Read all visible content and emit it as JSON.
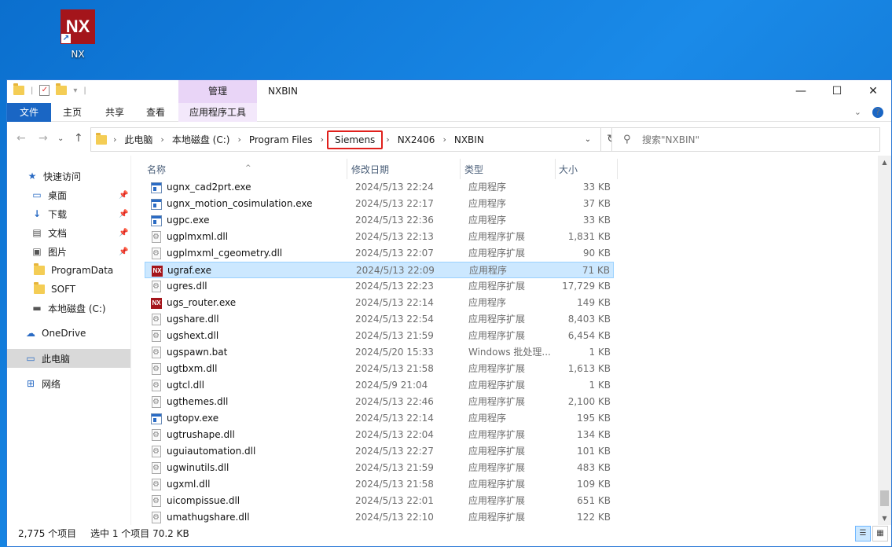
{
  "desktop": {
    "icon_label": "NX",
    "icon_logo": "NX"
  },
  "window": {
    "title": "NXBIN",
    "manage_tab": "管理",
    "app_tools_tab": "应用程序工具",
    "ribbon_tabs": [
      "文件",
      "主页",
      "共享",
      "查看"
    ]
  },
  "address": {
    "crumbs": [
      "此电脑",
      "本地磁盘 (C:)",
      "Program Files",
      "Siemens",
      "NX2406",
      "NXBIN"
    ],
    "highlighted": "Siemens"
  },
  "search": {
    "placeholder": "搜索\"NXBIN\""
  },
  "nav": {
    "items": [
      {
        "label": "快速访问",
        "icon": "star-icon",
        "pinned": false
      },
      {
        "label": "桌面",
        "icon": "desktop-icon",
        "pinned": true
      },
      {
        "label": "下载",
        "icon": "download-icon",
        "pinned": true
      },
      {
        "label": "文档",
        "icon": "document-icon",
        "pinned": true
      },
      {
        "label": "图片",
        "icon": "picture-icon",
        "pinned": true
      },
      {
        "label": "ProgramData",
        "icon": "folder-icon",
        "pinned": false
      },
      {
        "label": "SOFT",
        "icon": "folder-icon",
        "pinned": false
      },
      {
        "label": "本地磁盘 (C:)",
        "icon": "drive-icon",
        "pinned": false
      },
      {
        "label": "OneDrive",
        "icon": "cloud-icon",
        "pinned": false
      },
      {
        "label": "此电脑",
        "icon": "computer-icon",
        "pinned": false,
        "selected": true
      },
      {
        "label": "网络",
        "icon": "network-icon",
        "pinned": false
      }
    ]
  },
  "columns": {
    "name": "名称",
    "date": "修改日期",
    "type": "类型",
    "size": "大小"
  },
  "files": [
    {
      "name": "ugnx_cad2prt.exe",
      "date": "2024/5/13 22:24",
      "type": "应用程序",
      "size": "33 KB",
      "icon": "exe"
    },
    {
      "name": "ugnx_motion_cosimulation.exe",
      "date": "2024/5/13 22:17",
      "type": "应用程序",
      "size": "37 KB",
      "icon": "exe"
    },
    {
      "name": "ugpc.exe",
      "date": "2024/5/13 22:36",
      "type": "应用程序",
      "size": "33 KB",
      "icon": "exe"
    },
    {
      "name": "ugplmxml.dll",
      "date": "2024/5/13 22:13",
      "type": "应用程序扩展",
      "size": "1,831 KB",
      "icon": "dll"
    },
    {
      "name": "ugplmxml_cgeometry.dll",
      "date": "2024/5/13 22:07",
      "type": "应用程序扩展",
      "size": "90 KB",
      "icon": "dll"
    },
    {
      "name": "ugraf.exe",
      "date": "2024/5/13 22:09",
      "type": "应用程序",
      "size": "71 KB",
      "icon": "nx",
      "selected": true
    },
    {
      "name": "ugres.dll",
      "date": "2024/5/13 22:23",
      "type": "应用程序扩展",
      "size": "17,729 KB",
      "icon": "dll"
    },
    {
      "name": "ugs_router.exe",
      "date": "2024/5/13 22:14",
      "type": "应用程序",
      "size": "149 KB",
      "icon": "nx"
    },
    {
      "name": "ugshare.dll",
      "date": "2024/5/13 22:54",
      "type": "应用程序扩展",
      "size": "8,403 KB",
      "icon": "dll"
    },
    {
      "name": "ugshext.dll",
      "date": "2024/5/13 21:59",
      "type": "应用程序扩展",
      "size": "6,454 KB",
      "icon": "dll"
    },
    {
      "name": "ugspawn.bat",
      "date": "2024/5/20 15:33",
      "type": "Windows 批处理...",
      "size": "1 KB",
      "icon": "dll"
    },
    {
      "name": "ugtbxm.dll",
      "date": "2024/5/13 21:58",
      "type": "应用程序扩展",
      "size": "1,613 KB",
      "icon": "dll"
    },
    {
      "name": "ugtcl.dll",
      "date": "2024/5/9 21:04",
      "type": "应用程序扩展",
      "size": "1 KB",
      "icon": "dll"
    },
    {
      "name": "ugthemes.dll",
      "date": "2024/5/13 22:46",
      "type": "应用程序扩展",
      "size": "2,100 KB",
      "icon": "dll"
    },
    {
      "name": "ugtopv.exe",
      "date": "2024/5/13 22:14",
      "type": "应用程序",
      "size": "195 KB",
      "icon": "exe"
    },
    {
      "name": "ugtrushape.dll",
      "date": "2024/5/13 22:04",
      "type": "应用程序扩展",
      "size": "134 KB",
      "icon": "dll"
    },
    {
      "name": "uguiautomation.dll",
      "date": "2024/5/13 22:27",
      "type": "应用程序扩展",
      "size": "101 KB",
      "icon": "dll"
    },
    {
      "name": "ugwinutils.dll",
      "date": "2024/5/13 21:59",
      "type": "应用程序扩展",
      "size": "483 KB",
      "icon": "dll"
    },
    {
      "name": "ugxml.dll",
      "date": "2024/5/13 21:58",
      "type": "应用程序扩展",
      "size": "109 KB",
      "icon": "dll"
    },
    {
      "name": "uicompissue.dll",
      "date": "2024/5/13 22:01",
      "type": "应用程序扩展",
      "size": "651 KB",
      "icon": "dll"
    },
    {
      "name": "umathugshare.dll",
      "date": "2024/5/13 22:10",
      "type": "应用程序扩展",
      "size": "122 KB",
      "icon": "dll"
    }
  ],
  "status": {
    "count": "2,775 个项目",
    "selection": "选中 1 个项目  70.2 KB"
  },
  "colors": {
    "accent": "#1a66c4",
    "selection": "#cce8ff",
    "highlight_box": "#e0201c",
    "manage": "#e9d5f7"
  }
}
